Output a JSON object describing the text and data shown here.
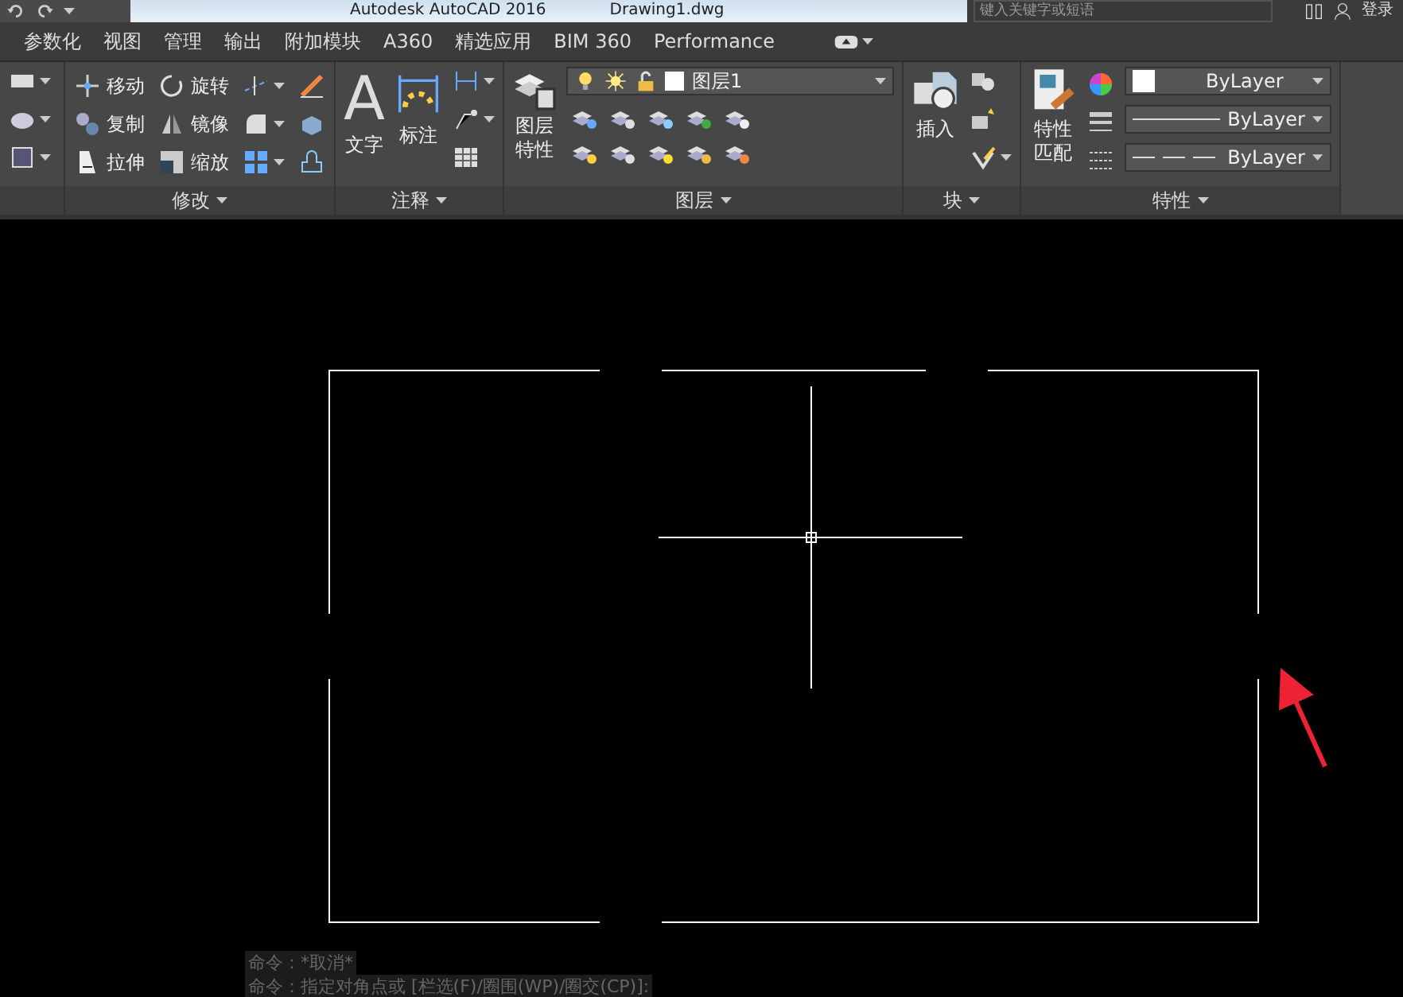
{
  "title_bar": {
    "app_title": "Autodesk AutoCAD 2016",
    "file_name": "Drawing1.dwg",
    "search": {
      "placeholder": "键入关键字或短语"
    },
    "login": "登录"
  },
  "tabs": [
    {
      "label": "参数化"
    },
    {
      "label": "视图"
    },
    {
      "label": "管理"
    },
    {
      "label": "输出"
    },
    {
      "label": "附加模块"
    },
    {
      "label": "A360"
    },
    {
      "label": "精选应用"
    },
    {
      "label": "BIM 360"
    },
    {
      "label": "Performance"
    }
  ],
  "ribbon": [
    {
      "kind": "modify",
      "title": "修改",
      "tools": [
        {
          "label": "移动"
        },
        {
          "label": "旋转"
        },
        {
          "label": "复制"
        },
        {
          "label": "镜像"
        },
        {
          "label": "拉伸"
        },
        {
          "label": "缩放"
        }
      ]
    },
    {
      "kind": "annotate",
      "title": "注释",
      "tools": [
        {
          "label": "文字",
          "glyph": "A"
        },
        {
          "label": "标注"
        }
      ]
    },
    {
      "kind": "layers",
      "title": "图层",
      "tools": [
        {
          "label": "图层特性"
        }
      ],
      "layer": "图层1"
    },
    {
      "kind": "block",
      "title": "块",
      "tools": [
        {
          "label": "插入"
        }
      ]
    },
    {
      "kind": "properties",
      "title": "特性",
      "tools": [
        {
          "label": "特性匹配"
        }
      ],
      "dropdowns": [
        {
          "kind": "color",
          "value": "ByLayer"
        },
        {
          "kind": "linetype",
          "value": "ByLayer"
        },
        {
          "kind": "lineweight",
          "value": "ByLayer"
        }
      ]
    }
  ],
  "command_history": [
    "命令：*取消*",
    "命令：指定对角点或 [栏选(F)/圈围(WP)/圈交(CP)]:"
  ]
}
